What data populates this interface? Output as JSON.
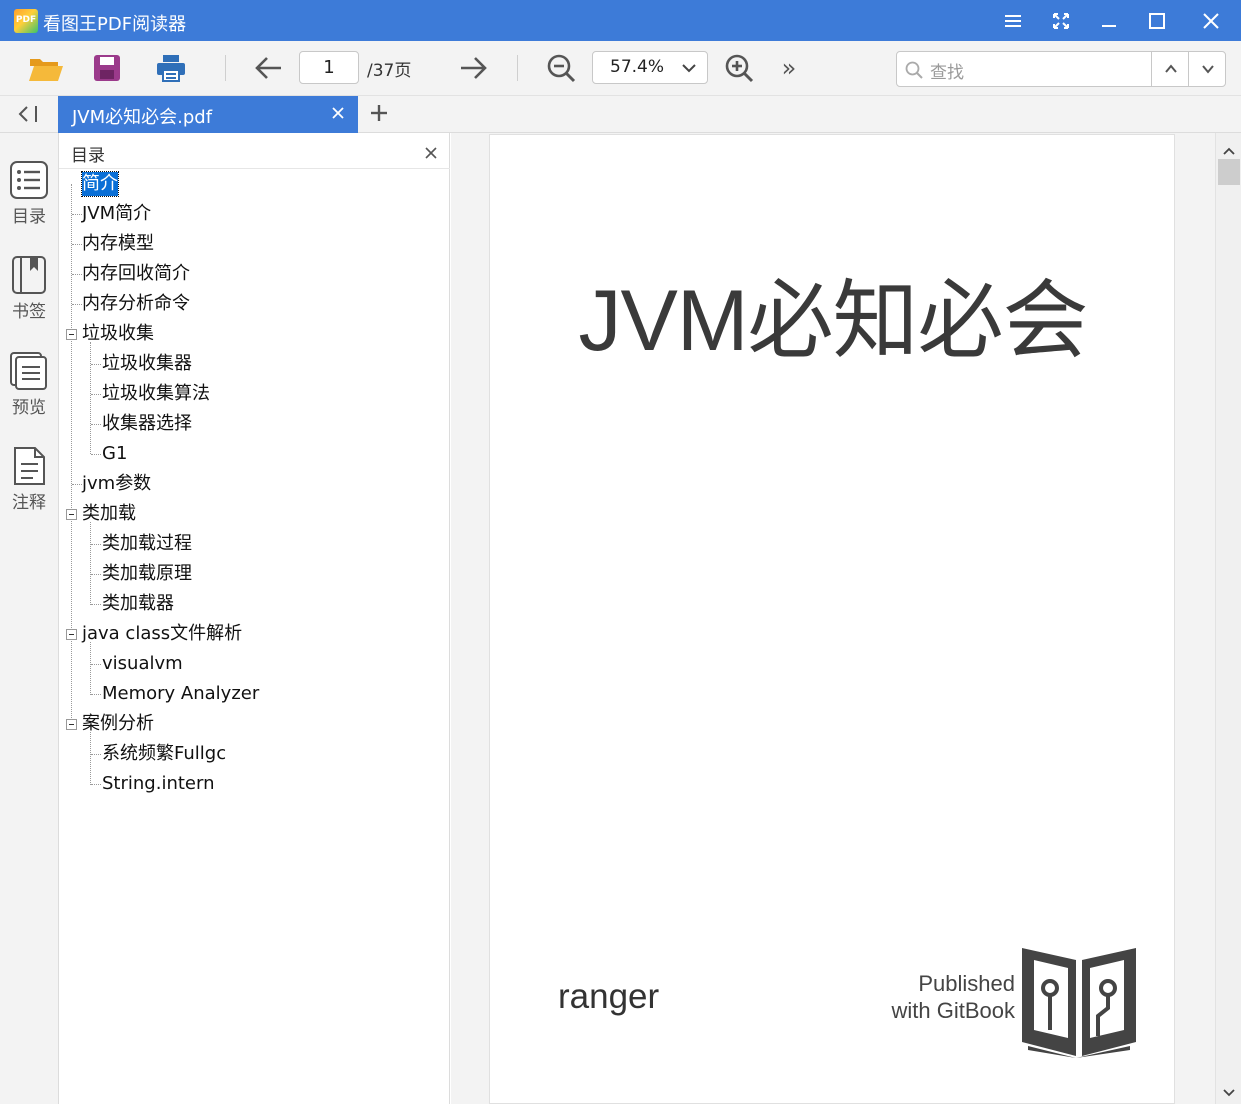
{
  "app": {
    "logo_text": "PDF",
    "title": "看图王PDF阅读器"
  },
  "toolbar": {
    "page_current": "1",
    "page_total": "/37页",
    "zoom": "57.4%",
    "search_placeholder": "查找",
    "more_label": "»"
  },
  "tabs": [
    {
      "label": "JVM必知必会.pdf",
      "active": true
    }
  ],
  "rail": {
    "items": [
      {
        "label": "目录",
        "icon": "list-icon",
        "active": true
      },
      {
        "label": "书签",
        "icon": "bookmark-icon"
      },
      {
        "label": "预览",
        "icon": "pages-preview-icon"
      },
      {
        "label": "注释",
        "icon": "annotation-icon"
      }
    ]
  },
  "toc": {
    "title": "目录",
    "items": [
      {
        "label": "简介",
        "level": 1,
        "selected": true
      },
      {
        "label": "JVM简介",
        "level": 1
      },
      {
        "label": "内存模型",
        "level": 1
      },
      {
        "label": "内存回收简介",
        "level": 1
      },
      {
        "label": "内存分析命令",
        "level": 1
      },
      {
        "label": "垃圾收集",
        "level": 1,
        "expanded": true
      },
      {
        "label": "垃圾收集器",
        "level": 2
      },
      {
        "label": "垃圾收集算法",
        "level": 2
      },
      {
        "label": "收集器选择",
        "level": 2
      },
      {
        "label": "G1",
        "level": 2
      },
      {
        "label": "jvm参数",
        "level": 1
      },
      {
        "label": "类加载",
        "level": 1,
        "expanded": true
      },
      {
        "label": "类加载过程",
        "level": 2
      },
      {
        "label": "类加载原理",
        "level": 2
      },
      {
        "label": "类加载器",
        "level": 2
      },
      {
        "label": "java class文件解析",
        "level": 1,
        "expanded": true
      },
      {
        "label": "visualvm",
        "level": 2
      },
      {
        "label": "Memory Analyzer",
        "level": 2
      },
      {
        "label": "案例分析",
        "level": 1,
        "expanded": true
      },
      {
        "label": "系统频繁Fullgc",
        "level": 2
      },
      {
        "label": "String.intern",
        "level": 2
      }
    ]
  },
  "document": {
    "title": "JVM必知必会",
    "author": "ranger",
    "published_line1": "Published",
    "published_line2": "with GitBook"
  },
  "colors": {
    "accent": "#3d7bd8",
    "selection": "#0a6fd6",
    "folder": "#f2a92c",
    "save": "#9b3a8b",
    "print": "#2f6fb8"
  }
}
